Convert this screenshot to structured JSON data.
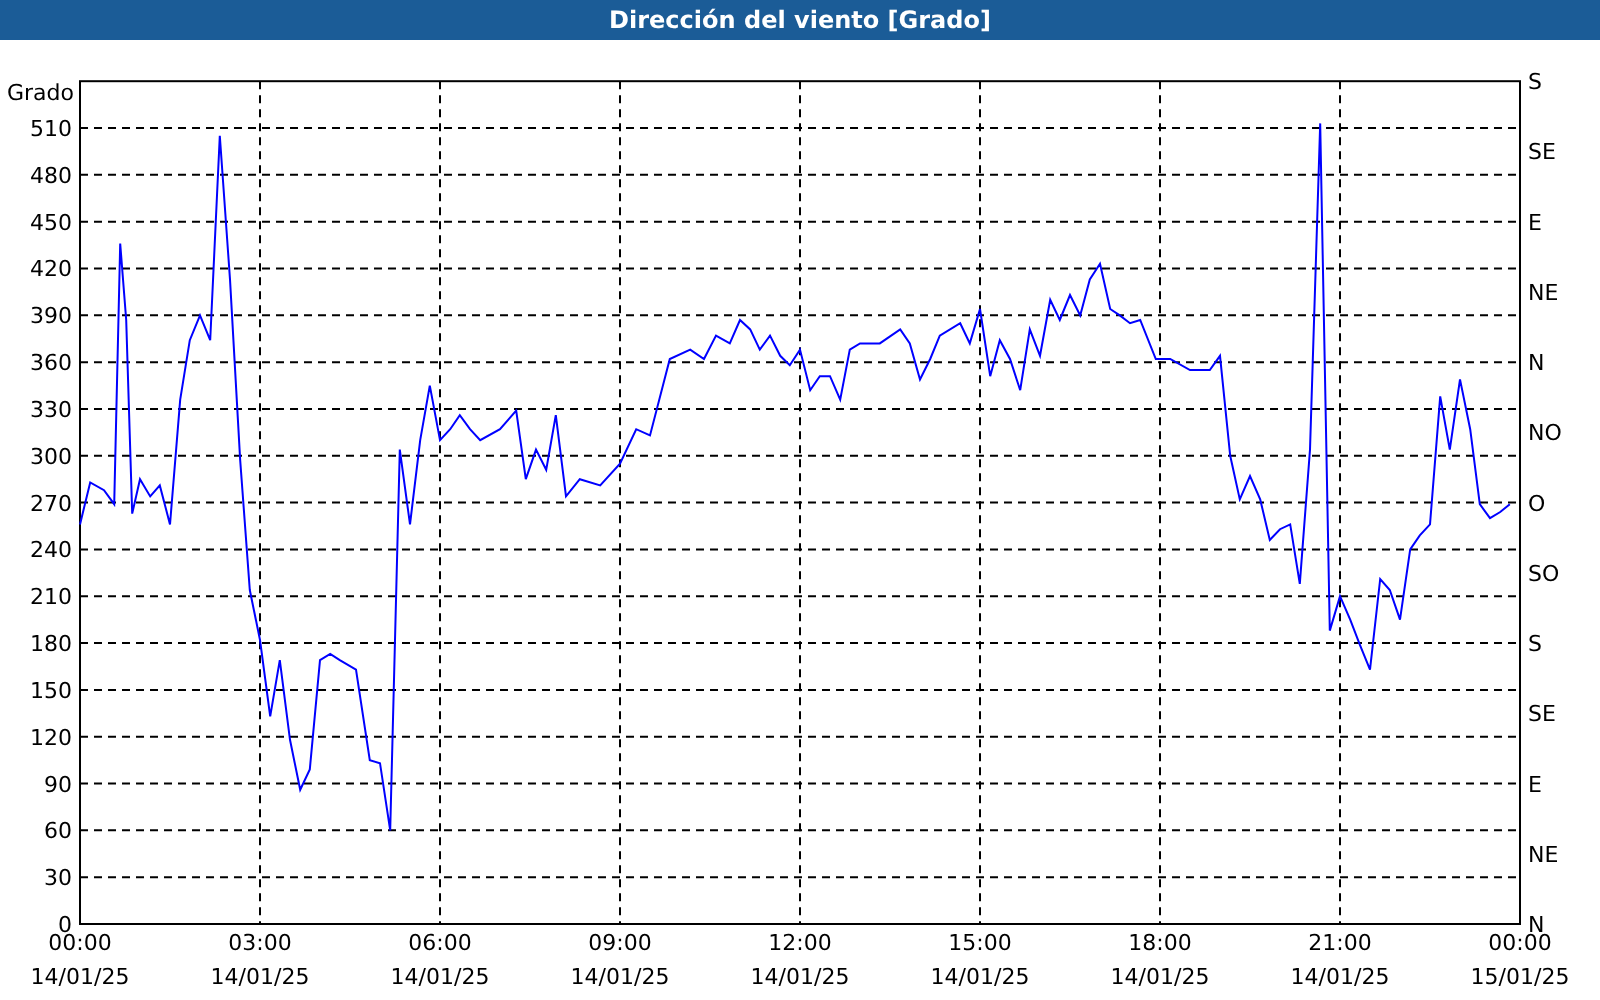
{
  "chart": {
    "chart_data": {
      "type": "line",
      "title": "Dirección del viento [Grado]",
      "ylabel": "Grado",
      "xlim": [
        0,
        24
      ],
      "grid": true,
      "ylim": [
        0,
        540
      ],
      "yticks": [
        0,
        30,
        60,
        90,
        120,
        150,
        180,
        210,
        240,
        270,
        300,
        330,
        360,
        390,
        420,
        450,
        480,
        510
      ],
      "xticks": [
        {
          "value": 0,
          "label": "00:00"
        },
        {
          "value": 3,
          "label": "03:00"
        },
        {
          "value": 6,
          "label": "06:00"
        },
        {
          "value": 9,
          "label": "09:00"
        },
        {
          "value": 12,
          "label": "12:00"
        },
        {
          "value": 15,
          "label": "15:00"
        },
        {
          "value": 18,
          "label": "18:00"
        },
        {
          "value": 21,
          "label": "21:00"
        },
        {
          "value": 24,
          "label": "00:00"
        }
      ],
      "x": [
        0,
        0.17,
        0.4,
        0.57,
        0.67,
        0.77,
        0.87,
        1,
        1.17,
        1.33,
        1.5,
        1.67,
        1.83,
        2,
        2.17,
        2.33,
        2.5,
        2.67,
        2.83,
        3,
        3.17,
        3.33,
        3.5,
        3.67,
        3.83,
        4,
        4.17,
        4.33,
        4.6,
        4.83,
        5,
        5.17,
        5.33,
        5.5,
        5.67,
        5.83,
        6,
        6.17,
        6.33,
        6.5,
        6.67,
        7,
        7.27,
        7.43,
        7.6,
        7.77,
        7.93,
        8.1,
        8.33,
        8.67,
        9,
        9.27,
        9.5,
        9.83,
        10.17,
        10.4,
        10.6,
        10.83,
        11,
        11.17,
        11.33,
        11.5,
        11.67,
        11.83,
        12,
        12.17,
        12.33,
        12.5,
        12.67,
        12.83,
        13,
        13.33,
        13.67,
        13.83,
        14,
        14.17,
        14.33,
        14.67,
        14.83,
        15,
        15.17,
        15.33,
        15.5,
        15.67,
        15.83,
        16,
        16.17,
        16.33,
        16.5,
        16.67,
        16.83,
        17,
        17.17,
        17.33,
        17.5,
        17.67,
        17.93,
        18.17,
        18.5,
        18.83,
        19,
        19.17,
        19.33,
        19.5,
        19.67,
        19.83,
        20,
        20.17,
        20.33,
        20.5,
        20.67,
        20.83,
        21,
        21.17,
        21.33,
        21.5,
        21.67,
        21.83,
        22,
        22.17,
        22.33,
        22.5,
        22.67,
        22.83,
        23,
        23.17,
        23.33,
        23.5,
        23.67,
        23.83
      ],
      "series": [
        {
          "color": "#0000ff",
          "values": [
            256,
            283,
            278,
            269,
            436,
            387,
            263,
            285,
            274,
            281,
            256,
            336,
            374,
            390,
            374,
            505,
            413,
            297,
            214,
            182,
            133,
            169,
            118,
            86,
            99,
            169,
            173,
            169,
            163,
            105,
            103,
            60,
            304,
            256,
            310,
            345,
            310,
            317,
            326,
            317,
            310,
            317,
            329,
            285,
            304,
            291,
            326,
            274,
            285,
            281,
            295,
            317,
            313,
            362,
            368,
            362,
            377,
            372,
            387,
            381,
            368,
            377,
            364,
            358,
            368,
            342,
            351,
            351,
            336,
            368,
            372,
            372,
            381,
            372,
            349,
            362,
            377,
            385,
            372,
            394,
            351,
            374,
            362,
            342,
            381,
            364,
            400,
            387,
            403,
            390,
            413,
            423,
            394,
            390,
            385,
            387,
            362,
            362,
            355,
            355,
            364,
            300,
            272,
            287,
            272,
            246,
            253,
            256,
            218,
            304,
            513,
            188,
            210,
            195,
            179,
            163,
            221,
            214,
            195,
            240,
            249,
            256,
            338,
            304,
            349,
            317,
            269,
            260,
            264,
            269
          ]
        }
      ]
    },
    "x_tick_dates": [
      "14/01/25",
      "14/01/25",
      "14/01/25",
      "14/01/25",
      "14/01/25",
      "14/01/25",
      "14/01/25",
      "14/01/25",
      "15/01/25"
    ],
    "right_ticks": [
      "S",
      "SE",
      "E",
      "NE",
      "N",
      "NO",
      "O",
      "SO",
      "S",
      "SE",
      "E",
      "NE",
      "N"
    ]
  }
}
